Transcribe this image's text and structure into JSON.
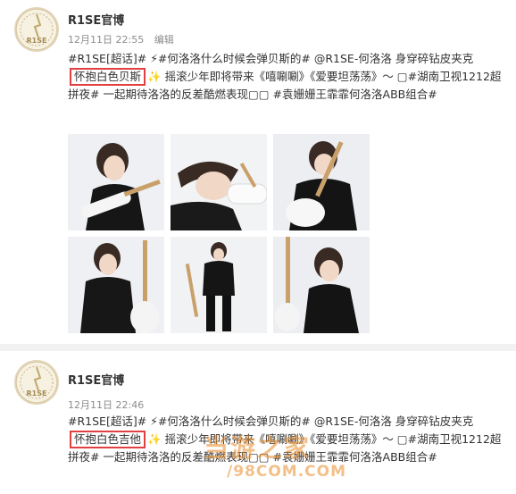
{
  "posts": [
    {
      "username": "R1SE官博",
      "time": "12月11日 22:55",
      "edited": "编辑",
      "text_before": "#R1SE[超话]# ⚡#何洛洛什么时候会弹贝斯的# @R1SE-何洛洛 身穿碎钻皮夹克",
      "highlight": "怀抱白色贝斯",
      "sparkle": "✨",
      "text_after": "摇滚少年即将带来《嘻唰唰》《爱要坦荡荡》～ ▢#湖南卫视1212超拼夜# 一起期待洛洛的反差酷燃表现▢▢ #袁姗姗王霏霏何洛洛ABB组合#",
      "photos": [
        "photo-guitar-sitting",
        "photo-lying-on-guitar",
        "photo-playing-guitar",
        "photo-standing-with-guitar",
        "photo-full-body-standing",
        "photo-kneeling-with-guitar"
      ]
    },
    {
      "username": "R1SE官博",
      "time": "12月11日 22:46",
      "text_before": "#R1SE[超话]# ⚡#何洛洛什么时候会弹贝斯的# @R1SE-何洛洛 身穿碎钻皮夹克",
      "highlight": "怀抱白色吉他",
      "sparkle": "✨",
      "text_after": "摇滚少年即将带来《嘻唰唰》《爱要坦荡荡》～ ▢#湖南卫视1212超拼夜# 一起期待洛洛的反差酷燃表现▢▢ #袁姗姗王霏霏何洛洛ABB组合#"
    }
  ],
  "watermark": {
    "main": "当游之家",
    "sub": "/98COM.COM"
  },
  "colors": {
    "highlight_border": "#e24040",
    "meta_gray": "#8c8c8c",
    "watermark": "#e88a28"
  }
}
